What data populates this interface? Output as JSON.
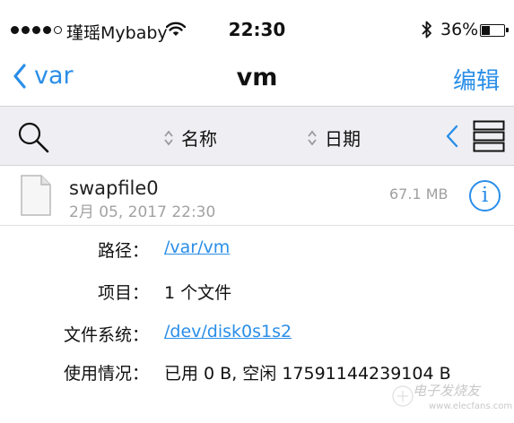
{
  "status_bar": {
    "carrier": "瑾瑶Mybaby",
    "time": "22:30",
    "battery_percent": "36%",
    "battery_level": 0.36,
    "icons": [
      "signal-dots-icon",
      "wifi-icon",
      "bluetooth-icon",
      "battery-icon"
    ]
  },
  "nav": {
    "back_label": "var",
    "title": "vm",
    "edit_label": "编辑"
  },
  "toolbar": {
    "sort_name_label": "名称",
    "sort_date_label": "日期",
    "icons": [
      "search-icon",
      "sort-arrows-icon",
      "chevron-left-icon",
      "list-view-icon"
    ]
  },
  "file": {
    "name": "swapfile0",
    "date": "2月 05, 2017 22:30",
    "size": "67.1 MB",
    "info_glyph": "i"
  },
  "details": [
    {
      "label": "路径：",
      "value": "/var/vm",
      "link": true
    },
    {
      "label": "项目：",
      "value": "1 个文件",
      "link": false
    },
    {
      "label": "文件系统：",
      "value": "/dev/disk0s1s2",
      "link": true
    },
    {
      "label": "使用情况：",
      "value": "已用 0 B, 空闲 17591144239104 B",
      "link": false
    }
  ],
  "watermark": {
    "text": "电子发烧友",
    "url": "www.elecfans.com"
  },
  "colors": {
    "accent": "#2a8ee8",
    "toolbar_bg": "#efeff3",
    "muted_text": "#a2a2a2"
  }
}
